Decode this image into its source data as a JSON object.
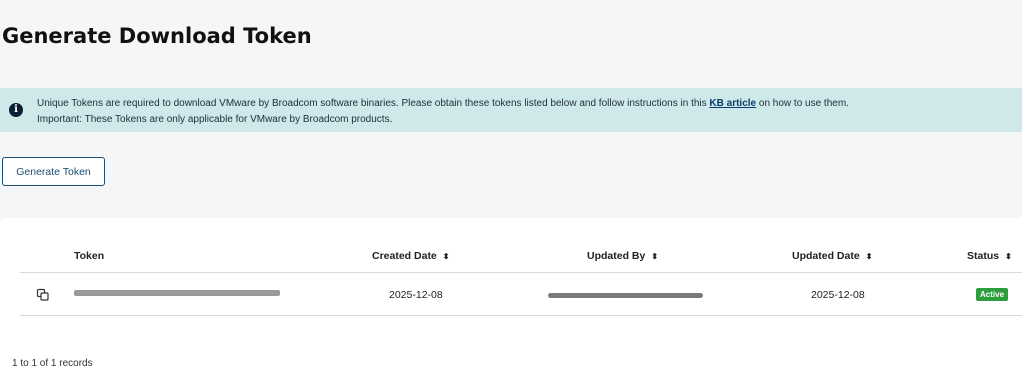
{
  "page_title": "Generate Download Token",
  "info_banner": {
    "text_before": "Unique Tokens are required to download VMware by Broadcom software binaries. Please obtain these tokens listed below and follow instructions in this ",
    "link_text": "KB article",
    "text_after": " on how to use them.",
    "line2": "Important: These Tokens are only applicable for VMware by Broadcom products."
  },
  "generate_button_label": "Generate Token",
  "table": {
    "columns": {
      "token": "Token",
      "created_date": "Created Date",
      "updated_by": "Updated By",
      "updated_date": "Updated Date",
      "status": "Status"
    },
    "sort_glyph": "⬍",
    "rows": [
      {
        "created_date": "2025-12-08",
        "updated_date": "2025-12-08",
        "status": "Active"
      }
    ]
  },
  "records_summary": "1 to 1 of 1 records",
  "colors": {
    "banner_bg": "#cfe8ea",
    "accent": "#1b4e72",
    "status_active": "#2e9d3e"
  }
}
